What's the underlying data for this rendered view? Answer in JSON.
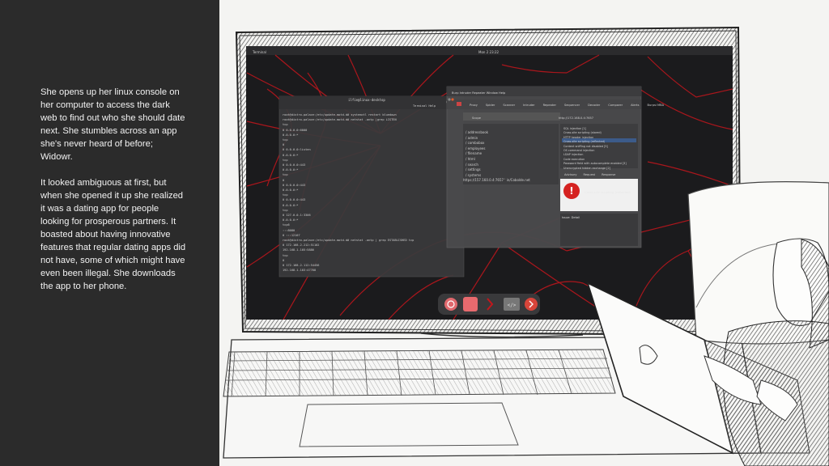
{
  "story": {
    "paragraph1": "She opens up her linux console on her computer to access the dark web to find out who she should date next. She stumbles across an app she's never heard of before; Widowr.",
    "paragraph2": "It looked ambiguous at first, but when she opened it up she realized it was a dating app for people looking for prosperous partners. It boasted about having innovative features that regular dating apps did not have, some of which might have even been illegal. She downloads the app to her phone."
  },
  "screen": {
    "topbar_left": "Terminal",
    "topbar_center": "Mon 2 23:22",
    "terminal": {
      "title": "ilfie@linux-desktop",
      "menu": "Terminal   Help",
      "lines": [
        "root@distro-palace:/etc/update-motd.d# systemctl restart bluedown",
        "root@distro-palace:/etc/update-motd.d# netstat -antp |grep LISTEN",
        "tcp",
        "0 0.0.0.0:6000",
        "0.0.0.0:*",
        "tcp",
        "0",
        "0 0.0.0.0:listen",
        "0.0.0.0:*",
        "tcp",
        "0 0.0.0.0:443",
        "0.0.0.0:*",
        "tcp",
        "0",
        "0 0.0.0.0:443",
        "0.0.0.0:*",
        "tcp",
        "0 0.0.0.0:443",
        "0.0.0.0:*",
        "tcp",
        "0 127.0.0.1:3306",
        "0.0.0.0:*",
        "tcp6",
        ":::8080",
        "0 :::12107",
        "root@distro-palace:/etc/update-motd.d# netstat -antp | grep ESTABLISHED tcp",
        "0 172.168.2.212:51102",
        "192.168.1.105:5886",
        "tcp",
        "0",
        "0 172.168.2.112:54456",
        "192.168.1.103:47768",
        "root@distro-palace:/etc/update-motd.d#",
        "131703",
        "131704",
        "131707"
      ]
    },
    "burp": {
      "menu": "Burp   Intruder   Repeater   Window   Help",
      "tabs": [
        "Proxy",
        "Spider",
        "Scanner",
        "Intruder",
        "Repeater",
        "Sequencer",
        "Decoder",
        "Comparer",
        "Alerts",
        "Burpsi MBA"
      ],
      "scope_label": "Scope",
      "host": "http://172.168.0.4:7657",
      "tree": [
        "/ addressbook",
        "/ admin",
        "/ combobox",
        "/ employees",
        "/ filename",
        "/ html",
        "/ search",
        "/ settings",
        "/ systems"
      ],
      "url": "https://157.160.0.4:7657 ' in/Cobolde.net",
      "issues": [
        "SQL injection [1]",
        "Cross-site scripting (stored)",
        "HTTP header injection",
        "Cross-site scripting (reflected)",
        "Content sniffing not disabled [5]",
        "OS command injection",
        "LDAP injection",
        "Code execution",
        "Password field with autocomplete enabled [3]",
        "Unencrypted hidden exchange [2]"
      ],
      "advisory_tabs": [
        "Advisory",
        "Request",
        "Response"
      ],
      "error_text": "Cross-site scripting (reflected)",
      "detail_title": "Issue: Detail"
    }
  },
  "colors": {
    "panel_bg": "#2b2b2b",
    "panel_text": "#f2f2f2",
    "screen_bg": "#1b1b1d",
    "web_red": "#c3161c",
    "error_red": "#d52220"
  }
}
